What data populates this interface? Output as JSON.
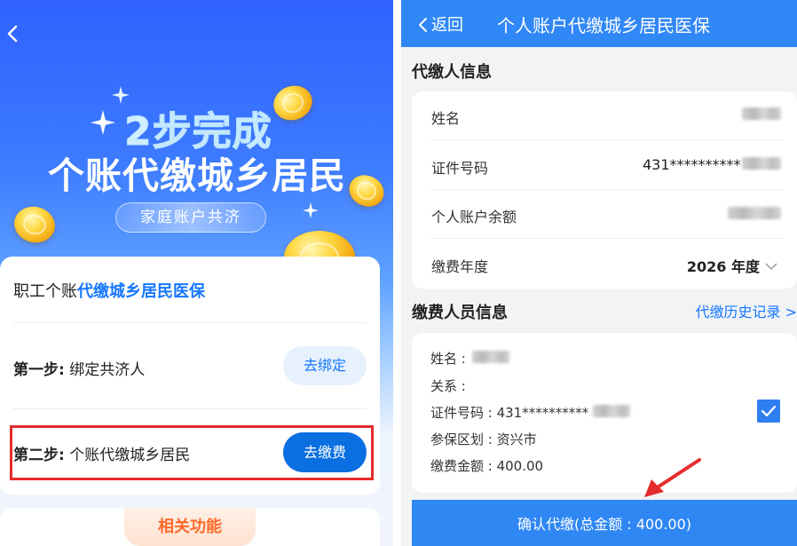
{
  "left": {
    "hero": {
      "line1": "2步完成",
      "line2": "个账代缴城乡居民",
      "pill": "家庭账户共济"
    },
    "card": {
      "head_prefix": "职工个账",
      "head_highlight": "代缴城乡居民医保",
      "step1_prefix": "第一步:",
      "step1_text": " 绑定共济人",
      "step1_button": "去绑定",
      "step2_prefix": "第二步:",
      "step2_text": " 个账代缴城乡居民",
      "step2_button": "去缴费"
    },
    "related_tab": "相关功能"
  },
  "right": {
    "nav": {
      "back_label": "返回",
      "title": "个人账户代缴城乡居民医保"
    },
    "payer_info": {
      "section_title": "代缴人信息",
      "name_label": "姓名",
      "id_label": "证件号码",
      "id_value": "431**********",
      "balance_label": "个人账户余额",
      "year_label": "缴费年度",
      "year_value": "2026 年度"
    },
    "insured_info": {
      "section_title": "缴费人员信息",
      "history_link": "代缴历史记录 >",
      "name_line": "姓名 :",
      "relation_line": "关系 :",
      "id_line": "证件号码 : 431**********",
      "region_line": "参保区划 : 资兴市",
      "amount_line": "缴费金额 : 400.00",
      "selected": true
    },
    "confirm_button": "确认代缴(总金额 : 400.00)"
  },
  "colors": {
    "accent_blue": "#1677ff",
    "nav_blue": "#3087f6",
    "highlight_red": "#e52c2c",
    "related_orange": "#ff6a2a"
  }
}
